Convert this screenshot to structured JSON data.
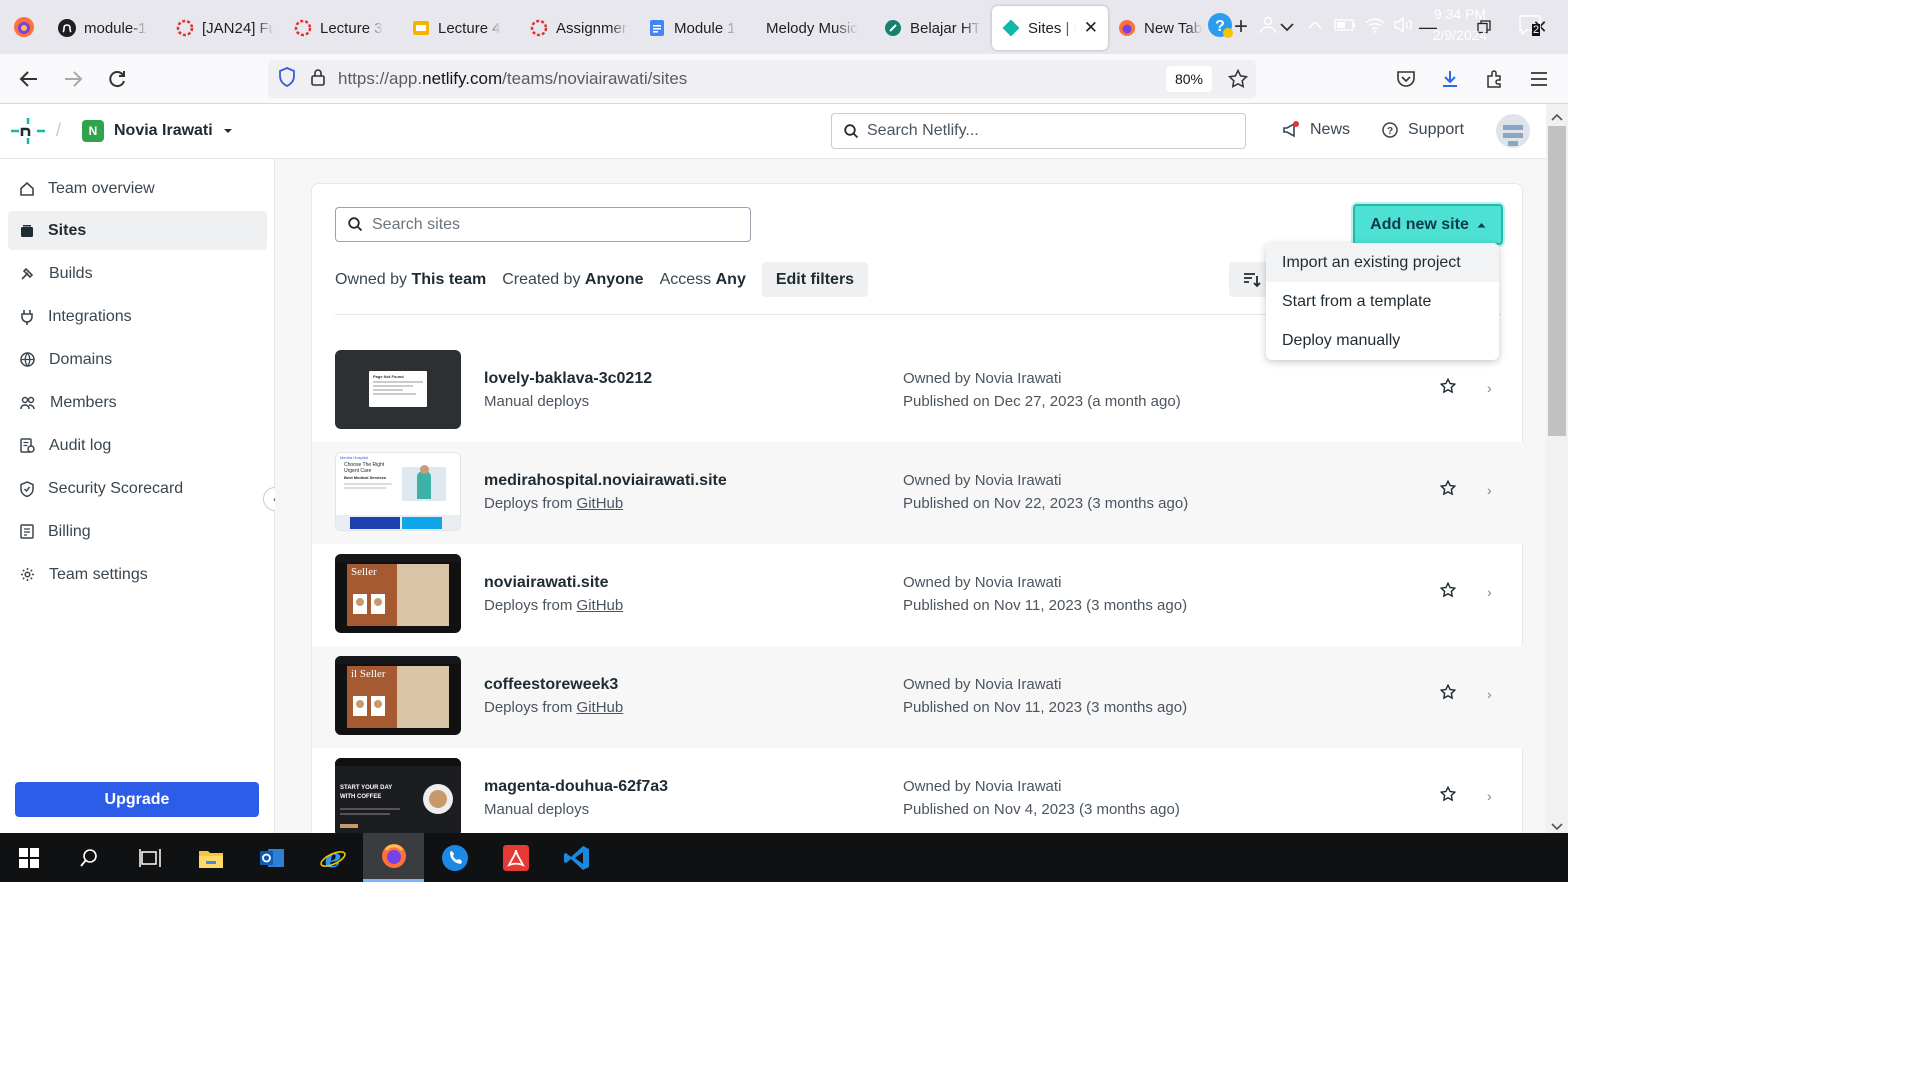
{
  "browser": {
    "tabs": [
      {
        "label": "module-1",
        "icon": "github-icon"
      },
      {
        "label": "[JAN24] Fu",
        "icon": "loading-icon"
      },
      {
        "label": "Lecture 3",
        "icon": "loading-icon"
      },
      {
        "label": "Lecture 4",
        "icon": "slides-icon"
      },
      {
        "label": "Assignmen",
        "icon": "loading-icon"
      },
      {
        "label": "Module 1",
        "icon": "docs-icon"
      },
      {
        "label": "Melody Music",
        "icon": "none"
      },
      {
        "label": "Belajar HT",
        "icon": "belajar-icon"
      },
      {
        "label": "Sites | n",
        "icon": "netlify-icon",
        "active": true
      },
      {
        "label": "New Tab",
        "icon": "firefox-icon"
      }
    ],
    "url_prefix": "https://app.",
    "url_domain": "netlify.com",
    "url_path": "/teams/noviairawati/sites",
    "zoom": "80%"
  },
  "header": {
    "team_initial": "N",
    "team_name": "Novia Irawati",
    "search_placeholder": "Search Netlify...",
    "news_label": "News",
    "support_label": "Support"
  },
  "sidebar": {
    "items": [
      {
        "label": "Team overview",
        "icon": "home-icon"
      },
      {
        "label": "Sites",
        "icon": "sites-icon",
        "active": true
      },
      {
        "label": "Builds",
        "icon": "builds-icon"
      },
      {
        "label": "Integrations",
        "icon": "plug-icon"
      },
      {
        "label": "Domains",
        "icon": "globe-icon"
      },
      {
        "label": "Members",
        "icon": "members-icon"
      },
      {
        "label": "Audit log",
        "icon": "audit-icon"
      },
      {
        "label": "Security Scorecard",
        "icon": "shield-icon"
      },
      {
        "label": "Billing",
        "icon": "billing-icon"
      },
      {
        "label": "Team settings",
        "icon": "gear-icon"
      }
    ],
    "upgrade_label": "Upgrade"
  },
  "sites_page": {
    "search_placeholder": "Search sites",
    "filters": {
      "owned_prefix": "Owned by",
      "owned_value": "This team",
      "created_prefix": "Created by",
      "created_value": "Anyone",
      "access_prefix": "Access",
      "access_value": "Any",
      "edit_label": "Edit filters"
    },
    "add_new_site_label": "Add new site",
    "add_menu": [
      "Import an existing project",
      "Start from a template",
      "Deploy manually"
    ],
    "sites": [
      {
        "name": "lovely-baklava-3c0212",
        "deploy_text": "Manual deploys",
        "deploy_link": "",
        "owner": "Owned by Novia Irawati",
        "published": "Published on Dec 27, 2023 (a month ago)"
      },
      {
        "name": "medirahospital.noviairawati.site",
        "deploy_text": "Deploys from ",
        "deploy_link": "GitHub",
        "owner": "Owned by Novia Irawati",
        "published": "Published on Nov 22, 2023 (3 months ago)"
      },
      {
        "name": "noviairawati.site",
        "deploy_text": "Deploys from ",
        "deploy_link": "GitHub",
        "owner": "Owned by Novia Irawati",
        "published": "Published on Nov 11, 2023 (3 months ago)"
      },
      {
        "name": "coffeestoreweek3",
        "deploy_text": "Deploys from ",
        "deploy_link": "GitHub",
        "owner": "Owned by Novia Irawati",
        "published": "Published on Nov 11, 2023 (3 months ago)"
      },
      {
        "name": "magenta-douhua-62f7a3",
        "deploy_text": "Manual deploys",
        "deploy_link": "",
        "owner": "Owned by Novia Irawati",
        "published": "Published on Nov 4, 2023 (3 months ago)"
      }
    ],
    "thumb_text": {
      "baklava": "Page Not Found",
      "medira_brand": "Medira Hospital",
      "medira_heading": "Choose The Right Urgent Care",
      "medira_sub": "Best Medical Services",
      "seller": "Seller",
      "seller2": "il Seller",
      "coffee": "START YOUR DAY WITH COFFEE"
    }
  },
  "taskbar": {
    "time": "9:34 PM",
    "date": "2/9/2024",
    "notification_count": "2"
  },
  "colors": {
    "accent_teal": "#4de1d3",
    "upgrade_blue": "#2d5ce8",
    "team_green": "#31a34c"
  }
}
